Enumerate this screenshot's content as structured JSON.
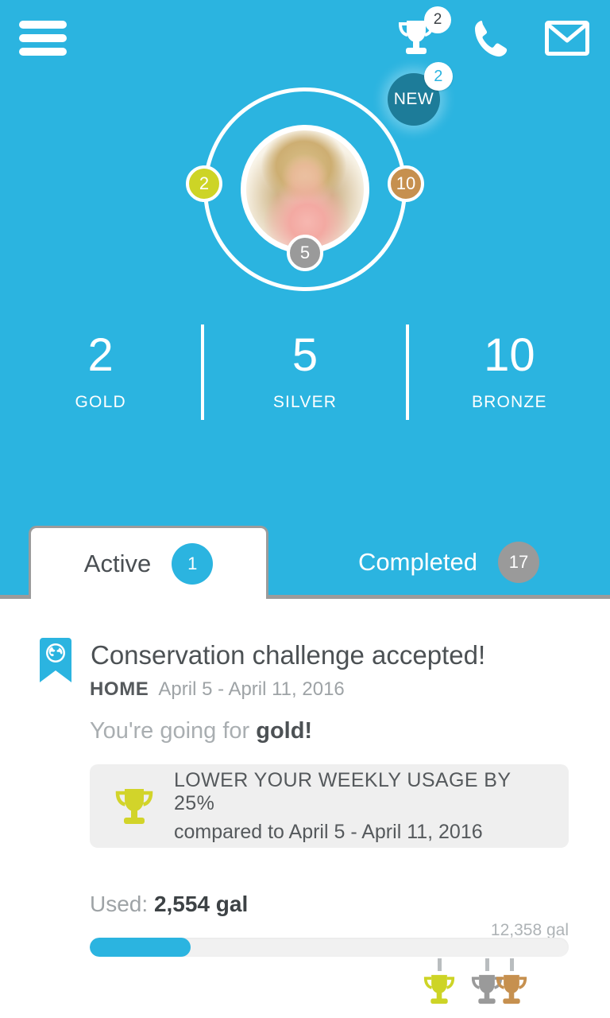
{
  "theme": {
    "brand_blue": "#2bb4e0",
    "gold": "#cdd426",
    "silver": "#9a9a9a",
    "bronze": "#c6904f",
    "new_badge": "#1d7c99",
    "card_bg": "#ffffff",
    "goal_box_bg": "#efefef"
  },
  "header": {
    "menu_icon": "hamburger-menu-icon",
    "trophy_icon": "trophy-icon",
    "trophy_badge_count": "2",
    "phone_icon": "phone-icon",
    "mail_icon": "envelope-icon"
  },
  "profile": {
    "avatar_icon": "user-avatar-photo",
    "new_badge_label": "NEW",
    "new_badge_count": "2",
    "ring_badges": {
      "gold": "2",
      "silver": "5",
      "bronze": "10"
    }
  },
  "stats": [
    {
      "value": "2",
      "label": "GOLD"
    },
    {
      "value": "5",
      "label": "SILVER"
    },
    {
      "value": "10",
      "label": "BRONZE"
    }
  ],
  "tabs": [
    {
      "label": "Active",
      "count": "1",
      "selected": true
    },
    {
      "label": "Completed",
      "count": "17",
      "selected": false
    }
  ],
  "challenge": {
    "icon": "ribbon-globe-icon",
    "title": "Conservation challenge accepted!",
    "location": "HOME",
    "date_range": "April 5 - April 11, 2016",
    "going_prefix": "You're going for ",
    "going_target": "gold!",
    "goal": {
      "trophy_icon": "gold-trophy-icon",
      "line1": "LOWER YOUR WEEKLY USAGE BY 25%",
      "line2": "compared to April 5 - April 11, 2016"
    },
    "usage": {
      "used_label": "Used: ",
      "used_value": "2,554 gal",
      "max_value": "12,358 gal",
      "progress_percent": 21,
      "markers": [
        {
          "medal": "gold",
          "icon": "gold-trophy-icon",
          "position_percent": 73
        },
        {
          "medal": "silver",
          "icon": "silver-trophy-icon",
          "position_percent": 83
        },
        {
          "medal": "bronze",
          "icon": "bronze-trophy-icon",
          "position_percent": 88
        }
      ]
    }
  }
}
